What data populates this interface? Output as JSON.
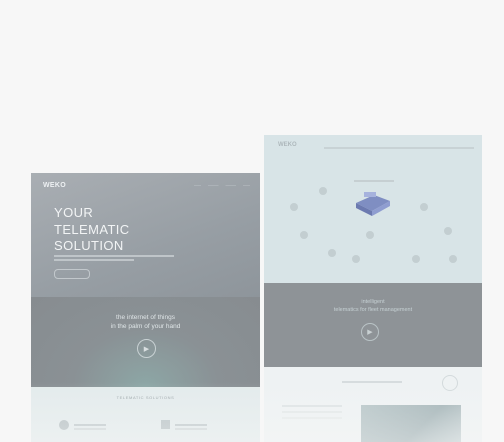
{
  "left_mockup": {
    "logo": "WEKO",
    "hero_title_lines": [
      "YOUR",
      "TELEMATIC",
      "SOLUTION"
    ],
    "band_text_lines": [
      "the internet of things",
      "in the palm of your hand"
    ],
    "features_title": "TELEMATIC SOLUTIONS"
  },
  "right_mockup": {
    "logo": "WEKO",
    "band_text_lines": [
      "intelligent",
      "telematics for fleet management"
    ]
  },
  "icons": {
    "play": "play-circle-icon"
  }
}
